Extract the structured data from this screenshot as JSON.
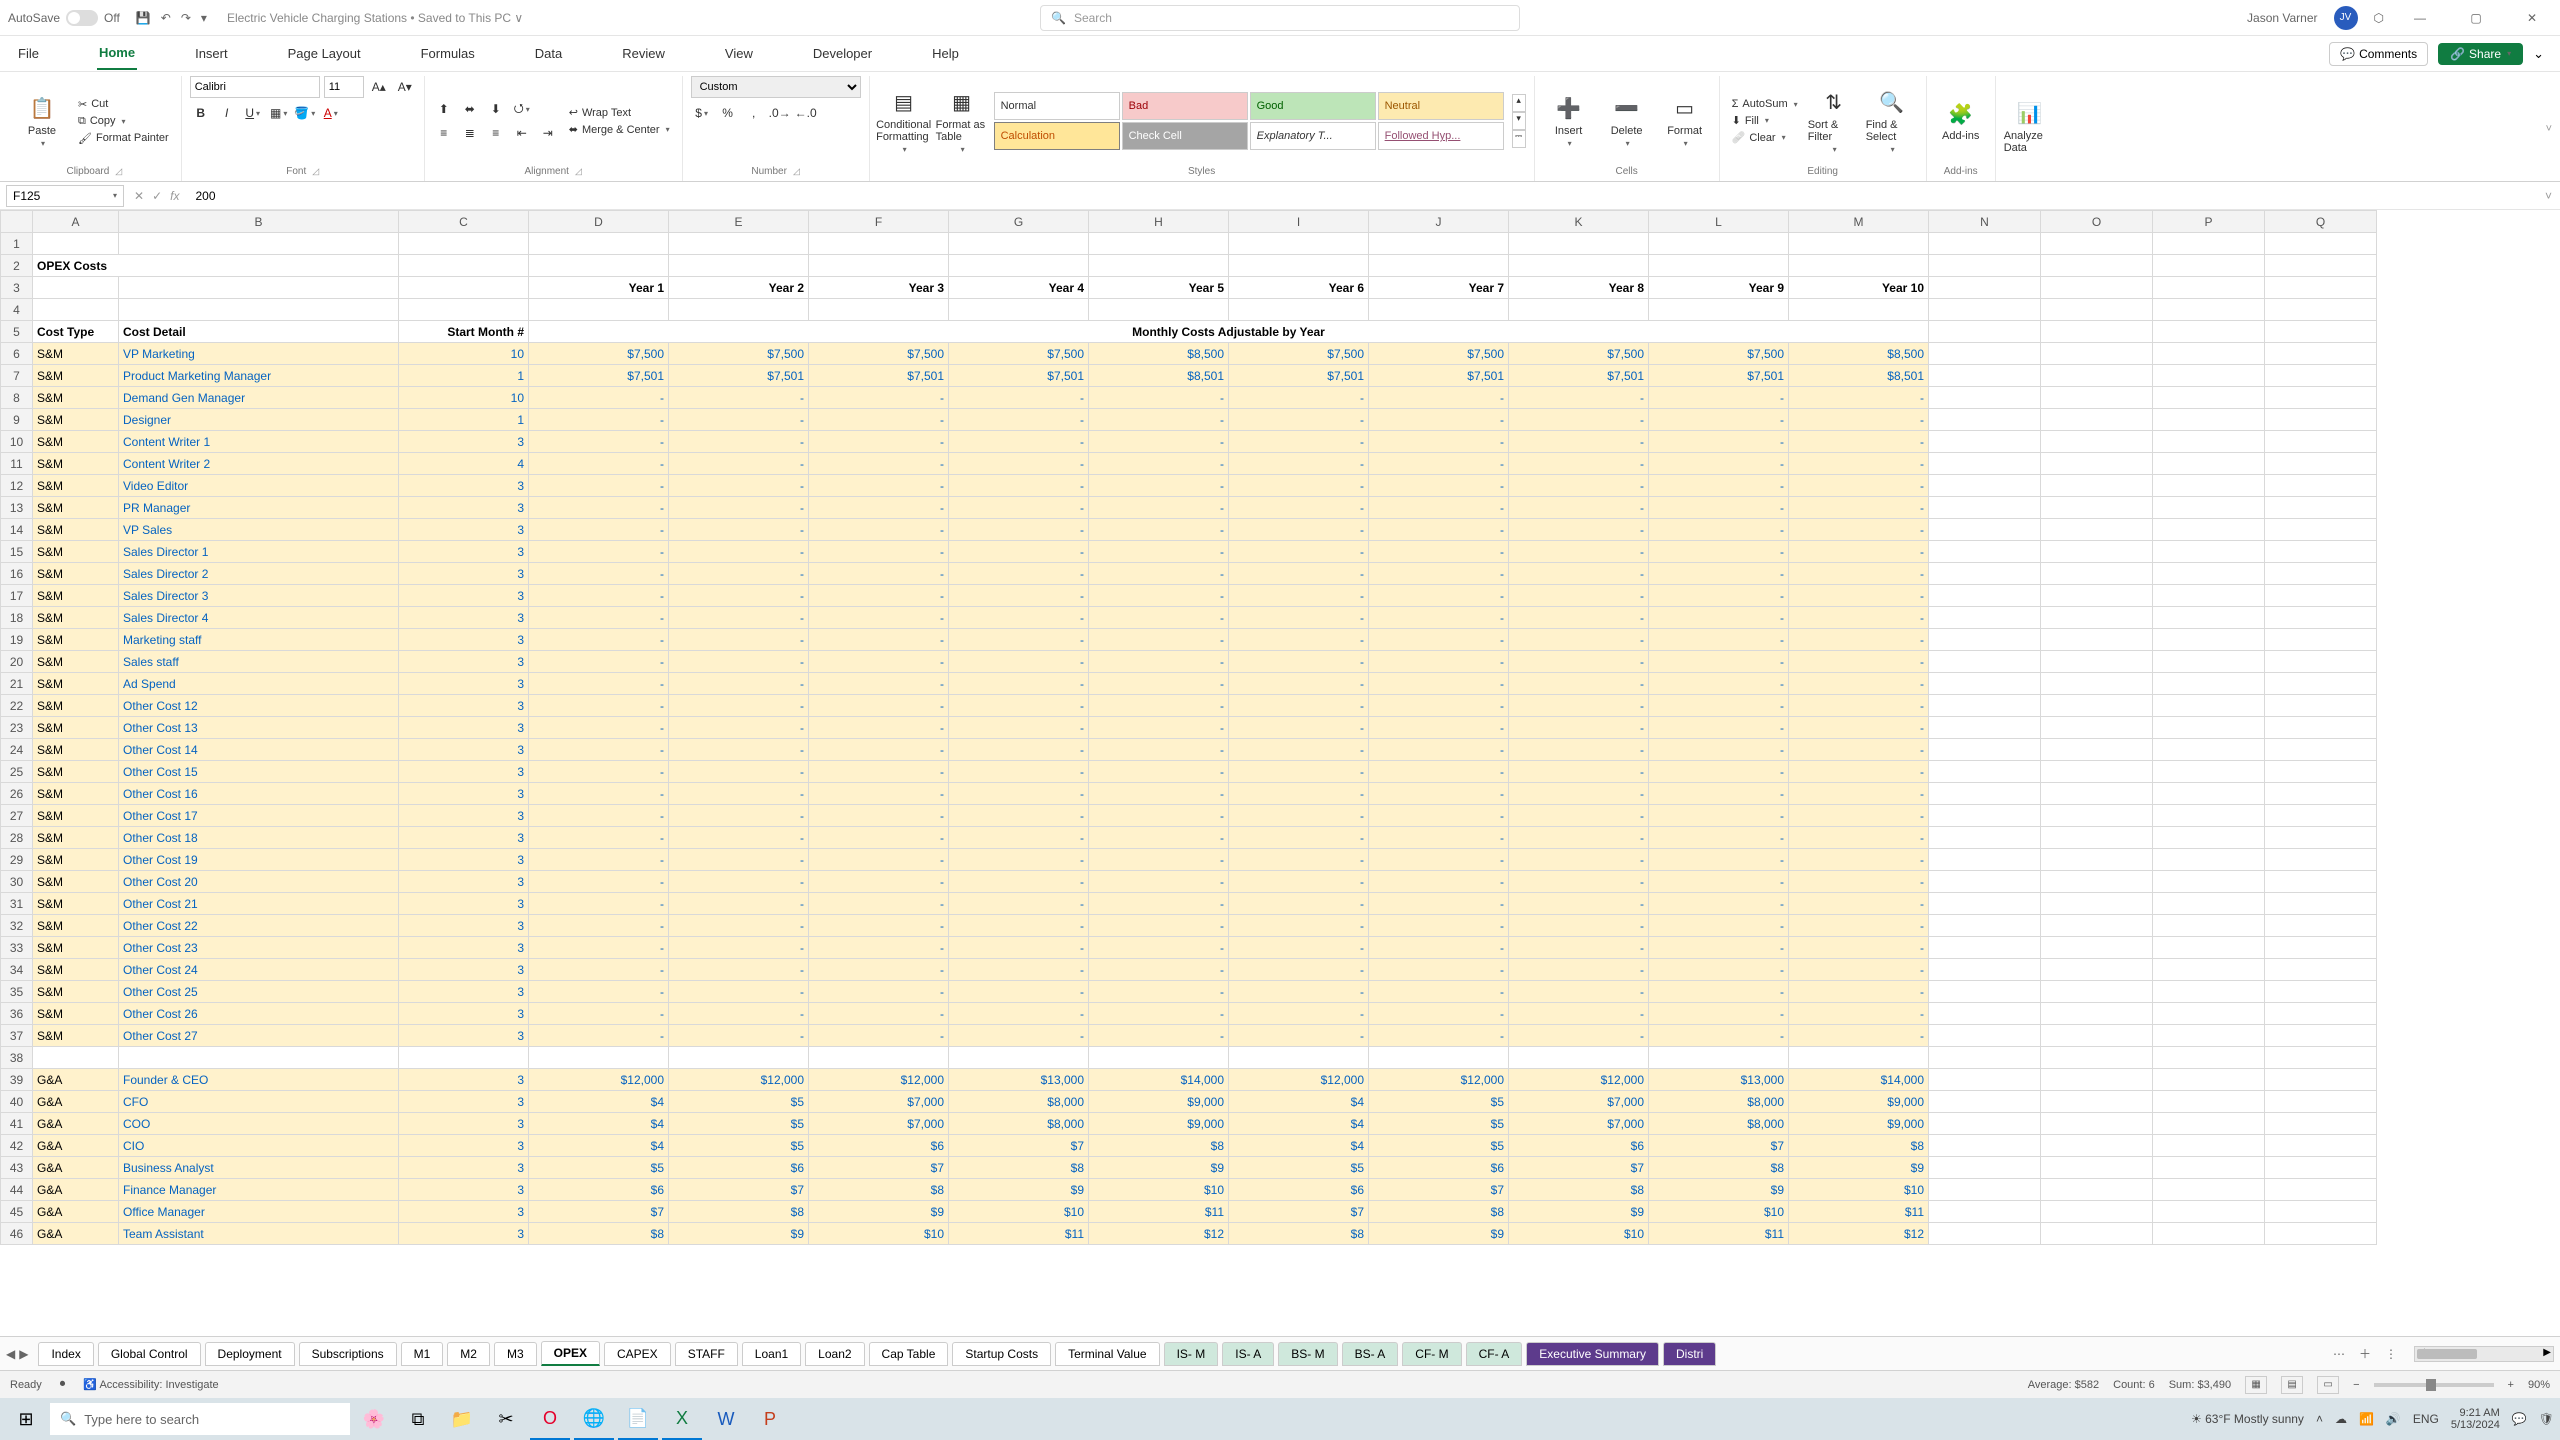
{
  "titlebar": {
    "autosave_label": "AutoSave",
    "autosave_state": "Off",
    "doc_title": "Electric Vehicle Charging Stations • Saved to This PC ∨",
    "search_placeholder": "Search",
    "user_name": "Jason Varner",
    "user_initials": "JV"
  },
  "ribbon_tabs": [
    "File",
    "Home",
    "Insert",
    "Page Layout",
    "Formulas",
    "Data",
    "Review",
    "View",
    "Developer",
    "Help"
  ],
  "ribbon_actions": {
    "comments": "Comments",
    "share": "Share"
  },
  "ribbon": {
    "clipboard": {
      "label": "Clipboard",
      "paste": "Paste",
      "cut": "Cut",
      "copy": "Copy",
      "format_painter": "Format Painter"
    },
    "font": {
      "label": "Font",
      "font_name": "Calibri",
      "font_size": "11"
    },
    "alignment": {
      "label": "Alignment",
      "wrap": "Wrap Text",
      "merge": "Merge & Center"
    },
    "number": {
      "label": "Number",
      "format": "Custom"
    },
    "styles": {
      "label": "Styles",
      "cond": "Conditional Formatting",
      "as_table": "Format as Table",
      "normal": "Normal",
      "bad": "Bad",
      "good": "Good",
      "neutral": "Neutral",
      "calculation": "Calculation",
      "check": "Check Cell",
      "explan": "Explanatory T...",
      "follow": "Followed Hyp..."
    },
    "cells": {
      "label": "Cells",
      "insert": "Insert",
      "delete": "Delete",
      "format": "Format"
    },
    "editing": {
      "label": "Editing",
      "autosum": "AutoSum",
      "fill": "Fill",
      "clear": "Clear",
      "sort": "Sort & Filter",
      "find": "Find & Select"
    },
    "addins": {
      "label": "Add-ins",
      "addins": "Add-ins"
    },
    "analysis": {
      "label": "",
      "analyze": "Analyze Data"
    }
  },
  "formula_bar": {
    "name_box": "F125",
    "formula": "200"
  },
  "columns": [
    "A",
    "B",
    "C",
    "D",
    "E",
    "F",
    "G",
    "H",
    "I",
    "J",
    "K",
    "L",
    "M",
    "N",
    "O",
    "P",
    "Q"
  ],
  "sheet": {
    "title": "OPEX Costs",
    "year_headers": [
      "Year 1",
      "Year 2",
      "Year 3",
      "Year 4",
      "Year 5",
      "Year 6",
      "Year 7",
      "Year 8",
      "Year 9",
      "Year 10"
    ],
    "header_row": {
      "cost_type": "Cost Type",
      "cost_detail": "Cost Detail",
      "start_month": "Start Month #",
      "monthly_label": "Monthly Costs Adjustable by Year"
    },
    "sm_type": "S&M",
    "ga_type": "G&A",
    "sm_rows": [
      {
        "detail": "VP Marketing",
        "start": "10",
        "vals": [
          "$7,500",
          "$7,500",
          "$7,500",
          "$7,500",
          "$8,500",
          "$7,500",
          "$7,500",
          "$7,500",
          "$7,500",
          "$8,500"
        ]
      },
      {
        "detail": "Product Marketing Manager",
        "start": "1",
        "vals": [
          "$7,501",
          "$7,501",
          "$7,501",
          "$7,501",
          "$8,501",
          "$7,501",
          "$7,501",
          "$7,501",
          "$7,501",
          "$8,501"
        ]
      },
      {
        "detail": "Demand Gen Manager",
        "start": "10",
        "vals": [
          "-",
          "-",
          "-",
          "-",
          "-",
          "-",
          "-",
          "-",
          "-",
          "-"
        ]
      },
      {
        "detail": "Designer",
        "start": "1",
        "vals": [
          "-",
          "-",
          "-",
          "-",
          "-",
          "-",
          "-",
          "-",
          "-",
          "-"
        ]
      },
      {
        "detail": "Content Writer 1",
        "start": "3",
        "vals": [
          "-",
          "-",
          "-",
          "-",
          "-",
          "-",
          "-",
          "-",
          "-",
          "-"
        ]
      },
      {
        "detail": "Content Writer 2",
        "start": "4",
        "vals": [
          "-",
          "-",
          "-",
          "-",
          "-",
          "-",
          "-",
          "-",
          "-",
          "-"
        ]
      },
      {
        "detail": "Video Editor",
        "start": "3",
        "vals": [
          "-",
          "-",
          "-",
          "-",
          "-",
          "-",
          "-",
          "-",
          "-",
          "-"
        ]
      },
      {
        "detail": "PR Manager",
        "start": "3",
        "vals": [
          "-",
          "-",
          "-",
          "-",
          "-",
          "-",
          "-",
          "-",
          "-",
          "-"
        ]
      },
      {
        "detail": "VP Sales",
        "start": "3",
        "vals": [
          "-",
          "-",
          "-",
          "-",
          "-",
          "-",
          "-",
          "-",
          "-",
          "-"
        ]
      },
      {
        "detail": "Sales Director 1",
        "start": "3",
        "vals": [
          "-",
          "-",
          "-",
          "-",
          "-",
          "-",
          "-",
          "-",
          "-",
          "-"
        ]
      },
      {
        "detail": "Sales Director 2",
        "start": "3",
        "vals": [
          "-",
          "-",
          "-",
          "-",
          "-",
          "-",
          "-",
          "-",
          "-",
          "-"
        ]
      },
      {
        "detail": "Sales Director 3",
        "start": "3",
        "vals": [
          "-",
          "-",
          "-",
          "-",
          "-",
          "-",
          "-",
          "-",
          "-",
          "-"
        ]
      },
      {
        "detail": "Sales Director 4",
        "start": "3",
        "vals": [
          "-",
          "-",
          "-",
          "-",
          "-",
          "-",
          "-",
          "-",
          "-",
          "-"
        ]
      },
      {
        "detail": "Marketing staff",
        "start": "3",
        "vals": [
          "-",
          "-",
          "-",
          "-",
          "-",
          "-",
          "-",
          "-",
          "-",
          "-"
        ]
      },
      {
        "detail": "Sales staff",
        "start": "3",
        "vals": [
          "-",
          "-",
          "-",
          "-",
          "-",
          "-",
          "-",
          "-",
          "-",
          "-"
        ]
      },
      {
        "detail": "Ad Spend",
        "start": "3",
        "vals": [
          "-",
          "-",
          "-",
          "-",
          "-",
          "-",
          "-",
          "-",
          "-",
          "-"
        ]
      },
      {
        "detail": "Other Cost 12",
        "start": "3",
        "vals": [
          "-",
          "-",
          "-",
          "-",
          "-",
          "-",
          "-",
          "-",
          "-",
          "-"
        ]
      },
      {
        "detail": "Other Cost 13",
        "start": "3",
        "vals": [
          "-",
          "-",
          "-",
          "-",
          "-",
          "-",
          "-",
          "-",
          "-",
          "-"
        ]
      },
      {
        "detail": "Other Cost 14",
        "start": "3",
        "vals": [
          "-",
          "-",
          "-",
          "-",
          "-",
          "-",
          "-",
          "-",
          "-",
          "-"
        ]
      },
      {
        "detail": "Other Cost 15",
        "start": "3",
        "vals": [
          "-",
          "-",
          "-",
          "-",
          "-",
          "-",
          "-",
          "-",
          "-",
          "-"
        ]
      },
      {
        "detail": "Other Cost 16",
        "start": "3",
        "vals": [
          "-",
          "-",
          "-",
          "-",
          "-",
          "-",
          "-",
          "-",
          "-",
          "-"
        ]
      },
      {
        "detail": "Other Cost 17",
        "start": "3",
        "vals": [
          "-",
          "-",
          "-",
          "-",
          "-",
          "-",
          "-",
          "-",
          "-",
          "-"
        ]
      },
      {
        "detail": "Other Cost 18",
        "start": "3",
        "vals": [
          "-",
          "-",
          "-",
          "-",
          "-",
          "-",
          "-",
          "-",
          "-",
          "-"
        ]
      },
      {
        "detail": "Other Cost 19",
        "start": "3",
        "vals": [
          "-",
          "-",
          "-",
          "-",
          "-",
          "-",
          "-",
          "-",
          "-",
          "-"
        ]
      },
      {
        "detail": "Other Cost 20",
        "start": "3",
        "vals": [
          "-",
          "-",
          "-",
          "-",
          "-",
          "-",
          "-",
          "-",
          "-",
          "-"
        ]
      },
      {
        "detail": "Other Cost 21",
        "start": "3",
        "vals": [
          "-",
          "-",
          "-",
          "-",
          "-",
          "-",
          "-",
          "-",
          "-",
          "-"
        ]
      },
      {
        "detail": "Other Cost 22",
        "start": "3",
        "vals": [
          "-",
          "-",
          "-",
          "-",
          "-",
          "-",
          "-",
          "-",
          "-",
          "-"
        ]
      },
      {
        "detail": "Other Cost 23",
        "start": "3",
        "vals": [
          "-",
          "-",
          "-",
          "-",
          "-",
          "-",
          "-",
          "-",
          "-",
          "-"
        ]
      },
      {
        "detail": "Other Cost 24",
        "start": "3",
        "vals": [
          "-",
          "-",
          "-",
          "-",
          "-",
          "-",
          "-",
          "-",
          "-",
          "-"
        ]
      },
      {
        "detail": "Other Cost 25",
        "start": "3",
        "vals": [
          "-",
          "-",
          "-",
          "-",
          "-",
          "-",
          "-",
          "-",
          "-",
          "-"
        ]
      },
      {
        "detail": "Other Cost 26",
        "start": "3",
        "vals": [
          "-",
          "-",
          "-",
          "-",
          "-",
          "-",
          "-",
          "-",
          "-",
          "-"
        ]
      },
      {
        "detail": "Other Cost 27",
        "start": "3",
        "vals": [
          "-",
          "-",
          "-",
          "-",
          "-",
          "-",
          "-",
          "-",
          "-",
          "-"
        ]
      }
    ],
    "ga_rows": [
      {
        "detail": "Founder & CEO",
        "start": "3",
        "vals": [
          "$12,000",
          "$12,000",
          "$12,000",
          "$13,000",
          "$14,000",
          "$12,000",
          "$12,000",
          "$12,000",
          "$13,000",
          "$14,000"
        ]
      },
      {
        "detail": "CFO",
        "start": "3",
        "vals": [
          "$4",
          "$5",
          "$7,000",
          "$8,000",
          "$9,000",
          "$4",
          "$5",
          "$7,000",
          "$8,000",
          "$9,000"
        ]
      },
      {
        "detail": "COO",
        "start": "3",
        "vals": [
          "$4",
          "$5",
          "$7,000",
          "$8,000",
          "$9,000",
          "$4",
          "$5",
          "$7,000",
          "$8,000",
          "$9,000"
        ]
      },
      {
        "detail": "CIO",
        "start": "3",
        "vals": [
          "$4",
          "$5",
          "$6",
          "$7",
          "$8",
          "$4",
          "$5",
          "$6",
          "$7",
          "$8"
        ]
      },
      {
        "detail": "Business Analyst",
        "start": "3",
        "vals": [
          "$5",
          "$6",
          "$7",
          "$8",
          "$9",
          "$5",
          "$6",
          "$7",
          "$8",
          "$9"
        ]
      },
      {
        "detail": "Finance Manager",
        "start": "3",
        "vals": [
          "$6",
          "$7",
          "$8",
          "$9",
          "$10",
          "$6",
          "$7",
          "$8",
          "$9",
          "$10"
        ]
      },
      {
        "detail": "Office Manager",
        "start": "3",
        "vals": [
          "$7",
          "$8",
          "$9",
          "$10",
          "$11",
          "$7",
          "$8",
          "$9",
          "$10",
          "$11"
        ]
      },
      {
        "detail": "Team Assistant",
        "start": "3",
        "vals": [
          "$8",
          "$9",
          "$10",
          "$11",
          "$12",
          "$8",
          "$9",
          "$10",
          "$11",
          "$12"
        ]
      }
    ]
  },
  "sheet_tabs": {
    "tabs": [
      "Index",
      "Global Control",
      "Deployment",
      "Subscriptions",
      "M1",
      "M2",
      "M3",
      "OPEX",
      "CAPEX",
      "STAFF",
      "Loan1",
      "Loan2",
      "Cap Table",
      "Startup Costs",
      "Terminal Value",
      "IS- M",
      "IS- A",
      "BS- M",
      "BS- A",
      "CF- M",
      "CF- A",
      "Executive Summary",
      "Distri"
    ],
    "active": "OPEX",
    "mint": [
      "IS- M",
      "IS- A",
      "BS- M",
      "BS- A",
      "CF- M",
      "CF- A"
    ],
    "purple": [
      "Executive Summary",
      "Distri"
    ]
  },
  "statusbar": {
    "ready": "Ready",
    "accessibility": "Accessibility: Investigate",
    "average": "Average: $582",
    "count": "Count: 6",
    "sum": "Sum: $3,490",
    "zoom": "90%"
  },
  "taskbar": {
    "search_placeholder": "Type here to search",
    "weather": "63°F  Mostly sunny",
    "time": "9:21 AM",
    "date": "5/13/2024"
  }
}
